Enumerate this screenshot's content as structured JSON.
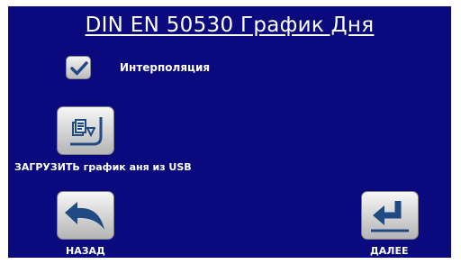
{
  "title": "DIN EN 50530 График Дня",
  "options": {
    "interpolation": {
      "label": "Интерполяция",
      "checked": true,
      "icon": "checkmark-icon"
    }
  },
  "buttons": {
    "load": {
      "label": "ЗАГРУЗИТЬ график аня из USB",
      "icon": "load-from-usb-icon"
    },
    "back": {
      "label": "НАЗАД",
      "icon": "back-arrow-icon"
    },
    "next": {
      "label": "ДАЛЕЕ",
      "icon": "enter-arrow-icon"
    }
  },
  "colors": {
    "background": "#0a0a7e",
    "text": "#ffffff",
    "button": "#d2d2d2",
    "icon": "#1f4a84"
  }
}
